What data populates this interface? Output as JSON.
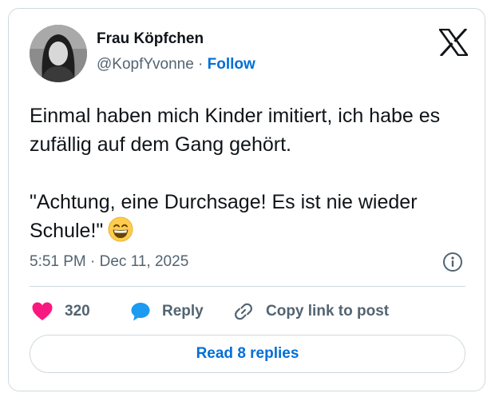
{
  "author": {
    "display_name": "Frau Köpfchen",
    "handle": "@KopfYvonne",
    "separator": "·",
    "follow_label": "Follow"
  },
  "tweet": {
    "paragraphs": [
      "Einmal haben mich Kinder imitiert, ich habe es zufällig auf dem Gang gehört.",
      "\"Achtung, eine Durchsage! Es ist nie wieder Schule!\""
    ],
    "emoji": "grinning-face-with-smiling-eyes",
    "timestamp": "5:51 PM · Dec 11, 2025"
  },
  "actions": {
    "like_count": "320",
    "reply_label": "Reply",
    "copy_link_label": "Copy link to post"
  },
  "footer": {
    "read_replies_label": "Read 8 replies"
  },
  "icons": {
    "logo": "x-logo-icon",
    "info": "info-icon",
    "like": "heart-icon",
    "reply": "speech-bubble-icon",
    "copy": "link-icon"
  },
  "colors": {
    "like": "#f91880",
    "reply": "#1d9bf0",
    "link": "#006fd6",
    "secondary_text": "#536471",
    "border": "#cfd9de"
  }
}
